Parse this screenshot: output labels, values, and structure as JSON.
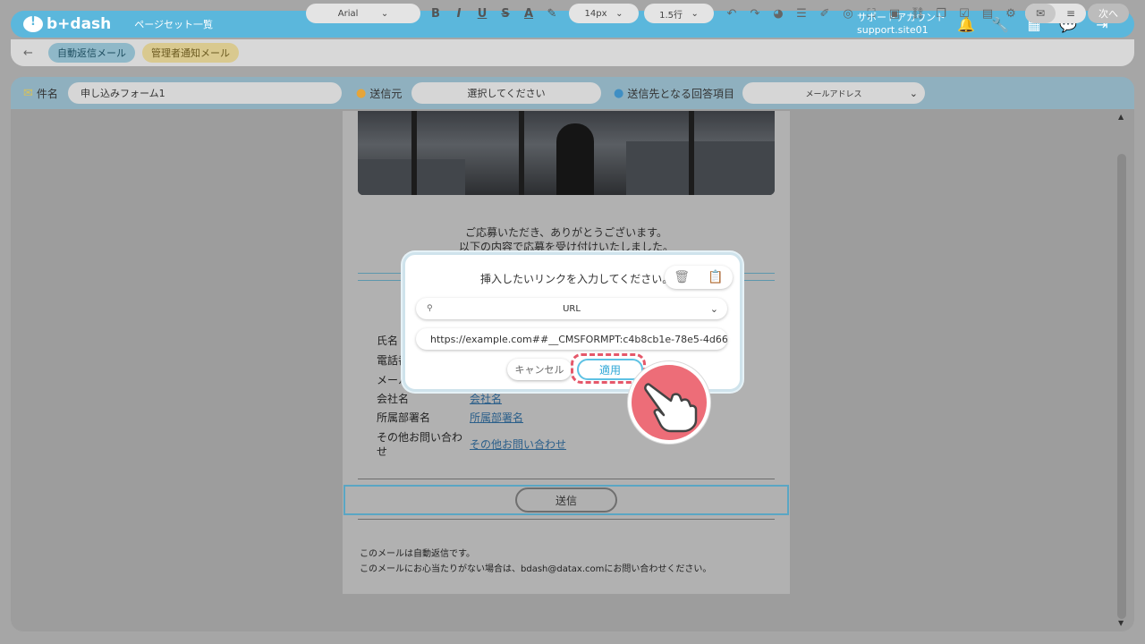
{
  "header": {
    "logo_text": "b+dash",
    "page_set_link": "ページセット一覧",
    "account_name": "サポートアカウント",
    "account_id": "support.site01",
    "icons": [
      "bell-icon",
      "wrench-icon",
      "grid-icon",
      "chat-icon",
      "logout-icon"
    ]
  },
  "toolbar": {
    "tabs": [
      {
        "label": "自動返信メール"
      },
      {
        "label": "管理者通知メール"
      }
    ],
    "font": "Arial",
    "format_buttons": [
      "B",
      "I",
      "U",
      "S",
      "A"
    ],
    "font_size": "14px",
    "line_height": "1.5行",
    "next_label": "次へ"
  },
  "fields": {
    "subject_label": "件名",
    "subject_value": "申し込みフォーム1",
    "sender_label": "送信元",
    "sender_placeholder": "選択してください",
    "recipient_label": "送信先となる回答項目",
    "recipient_value": "メールアドレス"
  },
  "email": {
    "thanks_line1": "ご応募いただき、ありがとうございます。",
    "thanks_line2": "以下の内容で応募を受け付けいたしました。",
    "rows": [
      {
        "label": "氏名",
        "value": ""
      },
      {
        "label": "電話番号",
        "value": ""
      },
      {
        "label": "メールアドレス",
        "value": ""
      },
      {
        "label": "会社名",
        "value": "会社名"
      },
      {
        "label": "所属部署名",
        "value": "所属部署名"
      },
      {
        "label": "その他お問い合わせ",
        "value": "その他お問い合わせ"
      }
    ],
    "submit_label": "送信",
    "footer_line1": "このメールは自動返信です。",
    "footer_line2": "このメールにお心当たりがない場合は、bdash@datax.comにお問い合わせください。"
  },
  "modal": {
    "title": "挿入したいリンクを入力してください。",
    "link_type": "URL",
    "url_value": "https://example.com##__CMSFORMPT:c4b8cb1e-78e5-4d66-8...",
    "cancel_label": "キャンセル",
    "apply_label": "適用"
  },
  "colors": {
    "brand": "#5bb7dc",
    "apply_border": "#5ec2e4",
    "highlight": "#e5586a"
  }
}
